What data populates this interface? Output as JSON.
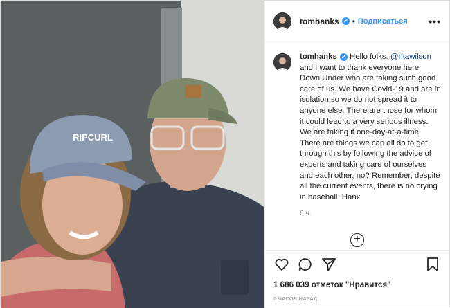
{
  "post": {
    "username": "tomhanks",
    "follow_label": "Подписаться",
    "separator": "•",
    "more_label": "•••",
    "verified_glyph": "✔",
    "caption_username": "tomhanks",
    "caption_before_mention": " Hello folks. ",
    "mention": "@ritawilson",
    "caption_after_mention": " and I want to thank everyone here Down Under who are taking such good care of us. We have Covid-19 and are in isolation so we do not spread it to anyone else. There are those for whom it could lead to a very serious illness. We are taking it one-day-at-a-time. There are things we can all do to get through this by following the advice of experts and taking care of ourselves and each other, no? Remember, despite all the current events, there is no crying in baseball. Hanx",
    "comment_time": "6 ч.",
    "load_more_glyph": "+",
    "likes": "1 686 039 отметок \"Нравится\"",
    "posted_ago": "6 ЧАСОВ НАЗАД",
    "photo_cap_text": "RIPCURL",
    "icons": [
      "heart-icon",
      "comment-icon",
      "share-icon",
      "bookmark-icon"
    ],
    "colors": {
      "accent": "#3897f0",
      "text": "#262626",
      "muted": "#8e8e8e",
      "mention": "#00376b"
    }
  }
}
